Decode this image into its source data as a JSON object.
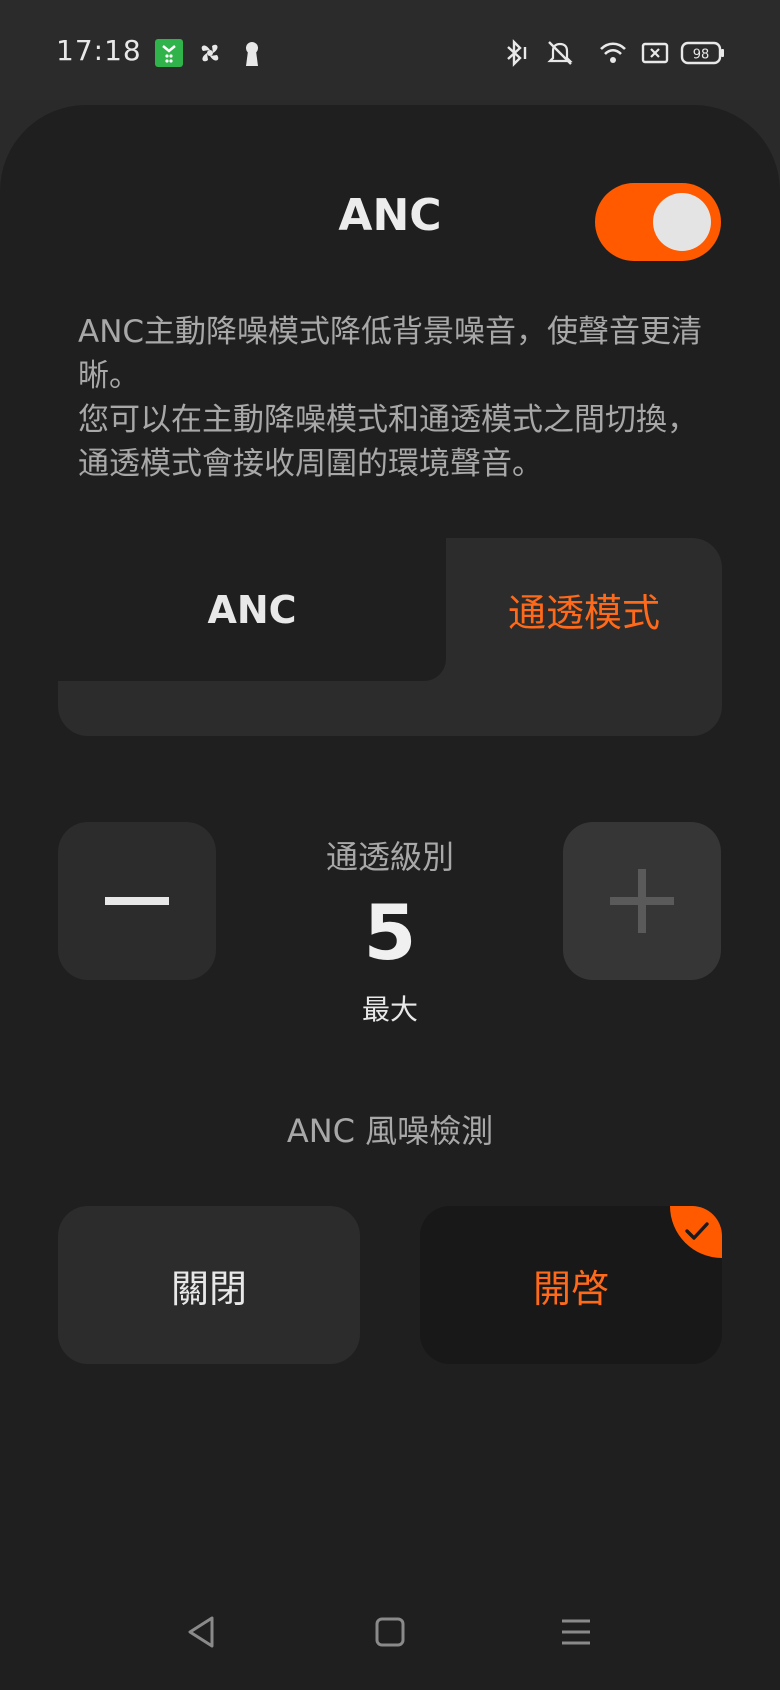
{
  "status_bar": {
    "time": "17:18",
    "battery": "98",
    "icons": [
      "app-notification-icon",
      "fan-icon",
      "keyhole-icon",
      "bluetooth-icon",
      "mute-icon",
      "wifi-icon",
      "sim-icon",
      "battery-icon"
    ]
  },
  "header": {
    "title": "ANC",
    "toggle_on": true
  },
  "description": {
    "line1": "ANC主動降噪模式降低背景噪音，使聲音更清晰。",
    "line2": "您可以在主動降噪模式和通透模式之間切換，通透模式會接收周圍的環境聲音。"
  },
  "mode_selector": {
    "anc_label": "ANC",
    "transparent_label": "通透模式",
    "selected": "transparent"
  },
  "level": {
    "label": "通透級別",
    "value": "5",
    "caption": "最大"
  },
  "wind_detection": {
    "label": "ANC 風噪檢測",
    "off_label": "關閉",
    "on_label": "開啓",
    "selected": "on"
  },
  "colors": {
    "accent": "#ff5a00",
    "background": "#1f1f1f",
    "card": "#2c2c2c"
  }
}
